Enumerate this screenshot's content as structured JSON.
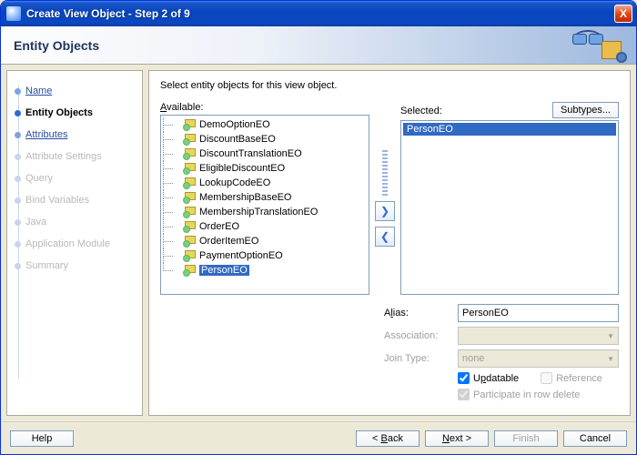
{
  "window": {
    "title": "Create View Object - Step 2 of 9",
    "close_symbol": "X"
  },
  "header": {
    "title": "Entity Objects"
  },
  "sidebar": {
    "steps": [
      {
        "label": "Name",
        "state": "done"
      },
      {
        "label": "Entity Objects",
        "state": "active"
      },
      {
        "label": "Attributes",
        "state": "done"
      },
      {
        "label": "Attribute Settings",
        "state": "pending"
      },
      {
        "label": "Query",
        "state": "pending"
      },
      {
        "label": "Bind Variables",
        "state": "pending"
      },
      {
        "label": "Java",
        "state": "pending"
      },
      {
        "label": "Application Module",
        "state": "pending"
      },
      {
        "label": "Summary",
        "state": "pending"
      }
    ]
  },
  "content": {
    "instruction": "Select entity objects for this view object.",
    "available_label_pre": "A",
    "available_label_post": "vailable:",
    "selected_label_pre": "",
    "selected_label_rest": "Selected:",
    "subtypes_label": "Subtypes...",
    "available_items": [
      "DemoOptionEO",
      "DiscountBaseEO",
      "DiscountTranslationEO",
      "EligibleDiscountEO",
      "LookupCodeEO",
      "MembershipBaseEO",
      "MembershipTranslationEO",
      "OrderEO",
      "OrderItemEO",
      "PaymentOptionEO",
      "PersonEO"
    ],
    "available_selected_index": 10,
    "selected_items": [
      "PersonEO"
    ],
    "shuttle": {
      "add": "❯",
      "remove": "❮"
    },
    "form": {
      "alias_label_pre": "A",
      "alias_label_mid": "l",
      "alias_label_post": "ias:",
      "alias_value": "PersonEO",
      "association_label": "Association:",
      "join_type_label": "Join Type:",
      "join_type_value": "none",
      "updatable_label_pre": "U",
      "updatable_label_mid": "p",
      "updatable_label_post": "datable",
      "updatable_checked": true,
      "reference_label": "Reference",
      "participate_label": "Participate in row delete"
    }
  },
  "footer": {
    "help": "Help",
    "back_pre": "< ",
    "back_u": "B",
    "back_post": "ack",
    "next_u": "N",
    "next_post": "ext >",
    "finish": "Finish",
    "cancel": "Cancel"
  }
}
